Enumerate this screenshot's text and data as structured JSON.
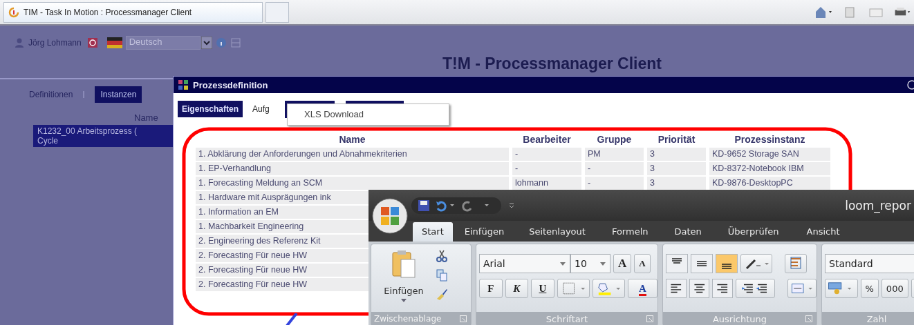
{
  "browser": {
    "tab_title": "TIM - Task In Motion : Processmanager Client"
  },
  "header": {
    "user": "Jörg Lohmann",
    "language": "Deutsch",
    "title": "T!M - Processmanager Client"
  },
  "left_panel": {
    "tabs": [
      {
        "label": "Definitionen",
        "selected": false
      },
      {
        "label": "Instanzen",
        "selected": true
      }
    ],
    "column": "Name",
    "rows": [
      {
        "lines": [
          "K1232_00 Arbeitsprozess (",
          "Cycle"
        ],
        "selected": true
      }
    ]
  },
  "dialog": {
    "title": "Prozessdefinition",
    "tabs": [
      {
        "label": "Eigenschaften",
        "selected": true
      },
      {
        "label": "Aufg",
        "selected": false
      },
      {
        "selected": true
      },
      {
        "selected": true
      }
    ],
    "popup_menu": {
      "items": [
        "XLS Download"
      ]
    },
    "table": {
      "columns": [
        "Name",
        "Bearbeiter",
        "Gruppe",
        "Priorität",
        "Prozessinstanz"
      ],
      "rows": [
        [
          "1. Abklärung der Anforderungen und Abnahmekriterien",
          "-",
          "PM",
          "3",
          "KD-9652 Storage SAN"
        ],
        [
          "1. EP-Verhandlung",
          "-",
          "-",
          "3",
          "KD-8372-Notebook IBM"
        ],
        [
          "1. Forecasting Meldung an SCM",
          "lohmann",
          "-",
          "3",
          "KD-9876-DesktopPC"
        ],
        [
          "1. Hardware mit Ausprägungen ink"
        ],
        [
          "1. Information an EM"
        ],
        [
          "1. Machbarkeit Engineering"
        ],
        [
          "2. Engineering des Referenz Kit"
        ],
        [
          "2. Forecasting Für neue HW"
        ],
        [
          "2. Forecasting Für neue HW"
        ],
        [
          "2. Forecasting Für neue HW"
        ]
      ]
    }
  },
  "annotations": [
    {
      "kind": "frame",
      "color": "#ff0000"
    },
    {
      "kind": "line",
      "color": "#3344dd"
    }
  ],
  "excel": {
    "title": "loom_repor",
    "tabs": [
      {
        "label": "Start",
        "selected": true
      },
      {
        "label": "Einfügen",
        "selected": false
      },
      {
        "label": "Seitenlayout",
        "selected": false
      },
      {
        "label": "Formeln",
        "selected": false
      },
      {
        "label": "Daten",
        "selected": false
      },
      {
        "label": "Überprüfen",
        "selected": false
      },
      {
        "label": "Ansicht",
        "selected": false
      }
    ],
    "clipboard": {
      "paste_label": "Einfügen",
      "group": "Zwischenablage"
    },
    "font": {
      "name": "Arial",
      "size": "10",
      "grow": "A",
      "shrink": "A",
      "styles": [
        "F",
        "K",
        "U"
      ],
      "color_button": "A",
      "group": "Schriftart"
    },
    "alignment": {
      "vertical": [
        {
          "selected": false
        },
        {
          "selected": false
        },
        {
          "selected": true
        }
      ],
      "group": "Ausrichtung"
    },
    "number": {
      "format": "Standard",
      "percent": "%",
      "thousands": "000",
      "group": "Zahl"
    }
  }
}
